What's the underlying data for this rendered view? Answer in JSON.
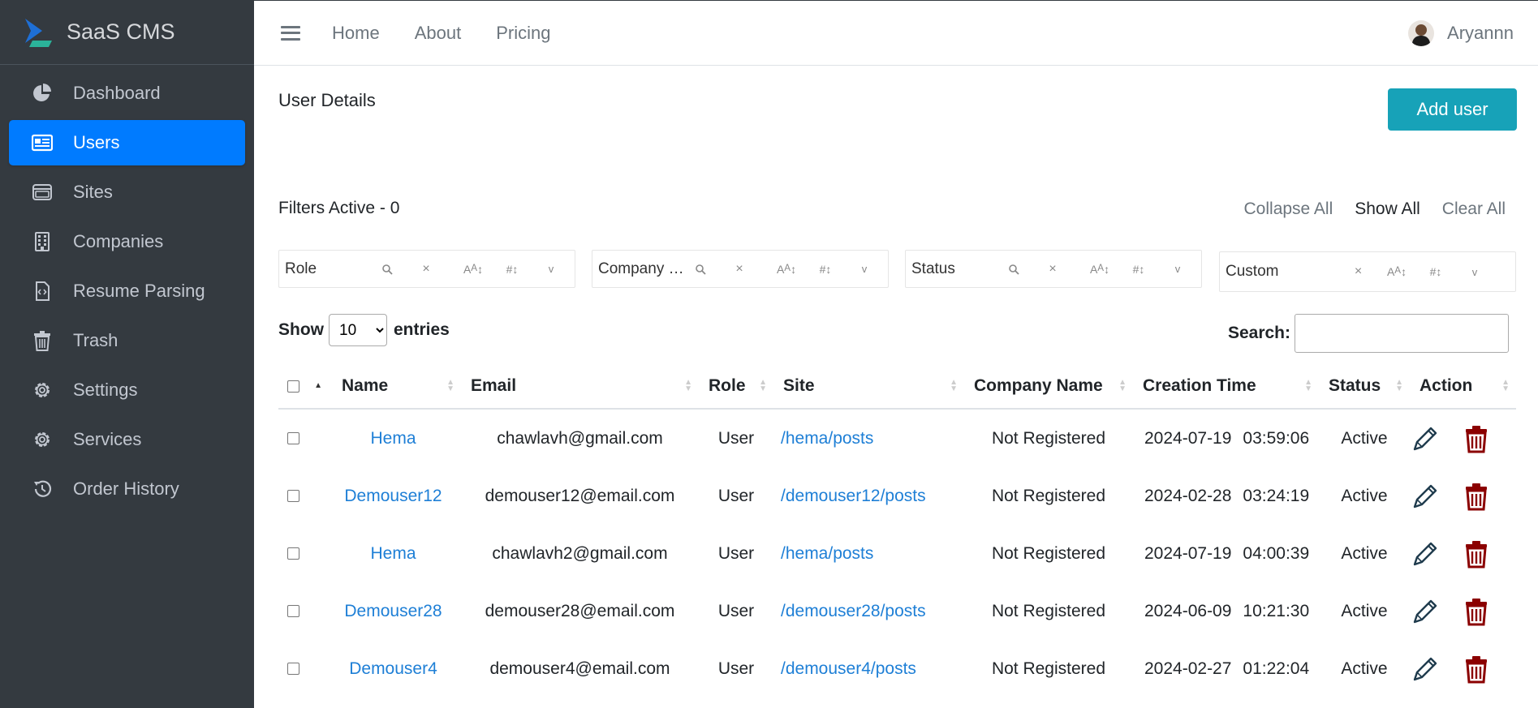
{
  "app": {
    "brand": "SaaS CMS"
  },
  "sidebar": {
    "items": [
      {
        "label": "Dashboard",
        "icon": "pie-chart-icon"
      },
      {
        "label": "Users",
        "icon": "id-card-icon",
        "active": true
      },
      {
        "label": "Sites",
        "icon": "window-icon"
      },
      {
        "label": "Companies",
        "icon": "building-icon"
      },
      {
        "label": "Resume Parsing",
        "icon": "code-file-icon"
      },
      {
        "label": "Trash",
        "icon": "trash-icon"
      },
      {
        "label": "Settings",
        "icon": "gear-icon"
      },
      {
        "label": "Services",
        "icon": "gear-icon"
      },
      {
        "label": "Order History",
        "icon": "history-icon"
      }
    ]
  },
  "topnav": {
    "links": [
      "Home",
      "About",
      "Pricing"
    ],
    "user_name": "Aryannn"
  },
  "page": {
    "title": "User Details",
    "add_user_label": "Add user",
    "filters_active": "Filters Active - 0",
    "filter_actions": [
      "Collapse All",
      "Show All",
      "Clear All"
    ],
    "filters": [
      "Role",
      "Company N…",
      "Status",
      "Custom"
    ],
    "show_label": "Show",
    "page_length": "10",
    "entries_label": "entries",
    "search_label": "Search:",
    "search_value": ""
  },
  "table": {
    "columns": [
      "Name",
      "Email",
      "Role",
      "Site",
      "Company Name",
      "Creation Time",
      "Status",
      "Action"
    ],
    "rows": [
      {
        "name": "Hema",
        "email": "chawlavh@gmail.com",
        "role": "User",
        "site": "/hema/posts",
        "company": "Not Registered",
        "date": "2024-07-19",
        "time": "03:59:06",
        "status": "Active"
      },
      {
        "name": "Demouser12",
        "email": "demouser12@email.com",
        "role": "User",
        "site": "/demouser12/posts",
        "company": "Not Registered",
        "date": "2024-02-28",
        "time": "03:24:19",
        "status": "Active"
      },
      {
        "name": "Hema",
        "email": "chawlavh2@gmail.com",
        "role": "User",
        "site": "/hema/posts",
        "company": "Not Registered",
        "date": "2024-07-19",
        "time": "04:00:39",
        "status": "Active"
      },
      {
        "name": "Demouser28",
        "email": "demouser28@email.com",
        "role": "User",
        "site": "/demouser28/posts",
        "company": "Not Registered",
        "date": "2024-06-09",
        "time": "10:21:30",
        "status": "Active"
      },
      {
        "name": "Demouser4",
        "email": "demouser4@email.com",
        "role": "User",
        "site": "/demouser4/posts",
        "company": "Not Registered",
        "date": "2024-02-27",
        "time": "01:22:04",
        "status": "Active"
      }
    ]
  },
  "colors": {
    "sidebar_bg": "#343a40",
    "active_item": "#007bff",
    "add_button": "#17a2b8",
    "link": "#1e7fd6",
    "edit_icon": "#1f3b4d",
    "delete_icon": "#8b0000"
  }
}
